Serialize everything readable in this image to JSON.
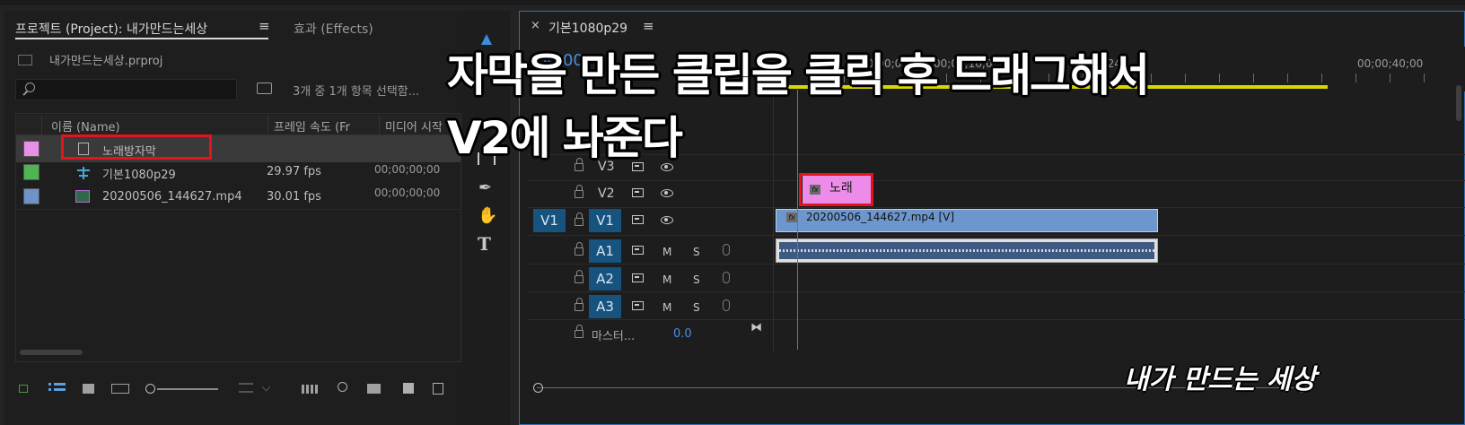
{
  "overlay": {
    "line1": "자막을 만든 클립을 클릭 후 드래그해서",
    "line2": "V2에 놔준다",
    "watermark": "내가 만드는 세상"
  },
  "project_panel": {
    "tab_project": "프로젝트 (Project): 내가만드는세상",
    "tab_menu": "≡",
    "tab_effects": "효과 (Effects)",
    "file_name": "내가만드는세상.prproj",
    "search_placeholder": "",
    "selection_info": "3개 중 1개 항목 선택함...",
    "columns": {
      "name": "이름 (Name)",
      "frame_rate": "프레임 속도 (Fr",
      "media_start": "미디어 시작"
    },
    "items": [
      {
        "name": "노래방자막",
        "fps": "",
        "start": "",
        "color": "#e88fe8"
      },
      {
        "name": "기본1080p29",
        "fps": "29.97 fps",
        "start": "00;00;00;00",
        "color": "#4fb552"
      },
      {
        "name": "20200506_144627.mp4",
        "fps": "30.01 fps",
        "start": "00;00;00;00",
        "color": "#6e93c8"
      }
    ]
  },
  "timeline": {
    "tab_close": "×",
    "sequence_name": "기본1080p29",
    "tab_menu": "≡",
    "timecode_partial": "00;00;",
    "ruler_labels": [
      "00;00;0",
      "00;00;16;0",
      "00;00;24;",
      "00;00;40;00"
    ],
    "tracks_video": [
      {
        "label": "V3"
      },
      {
        "label": "V2"
      },
      {
        "label": "V1",
        "source": "V1"
      }
    ],
    "tracks_audio": [
      {
        "label": "A1"
      },
      {
        "label": "A2"
      },
      {
        "label": "A3"
      }
    ],
    "mute": "M",
    "solo": "S",
    "master_label": "마스터...",
    "master_value": "0.0",
    "clips": {
      "caption": "노래",
      "video": "20200506_144627.mp4 [V]",
      "fx": "fx"
    }
  }
}
